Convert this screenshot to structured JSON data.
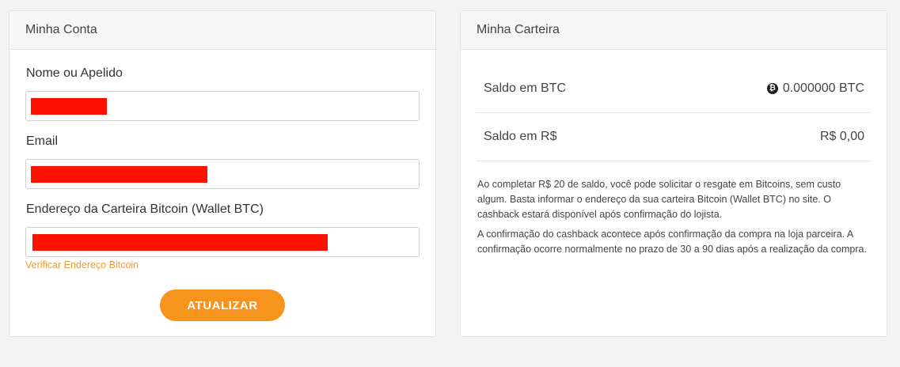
{
  "account": {
    "title": "Minha Conta",
    "fields": [
      {
        "label": "Nome ou Apelido",
        "value": ""
      },
      {
        "label": "Email",
        "value": ""
      },
      {
        "label": "Endereço da Carteira Bitcoin (Wallet BTC)",
        "value": ""
      }
    ],
    "verify_link": "Verificar Endereço Bitcoin",
    "submit_label": "ATUALIZAR"
  },
  "wallet": {
    "title": "Minha Carteira",
    "btc_label": "Saldo em BTC",
    "btc_value": "0.000000 BTC",
    "brl_label": "Saldo em R$",
    "brl_value": "R$ 0,00",
    "note1": "Ao completar R$ 20 de saldo, você pode solicitar o resgate em Bitcoins, sem custo algum. Basta informar o endereço da sua carteira Bitcoin (Wallet BTC) no site. O cashback estará disponível após confirmação do lojista.",
    "note2": "A confirmação do cashback acontece após confirmação da compra na loja parceira. A confirmação ocorre normalmente no prazo de 30 a 90 dias após a realização da compra."
  },
  "colors": {
    "accent": "#f7941d",
    "link": "#ef9a3a",
    "redaction": "#ff1100"
  },
  "icons": {
    "btc": "bitcoin-icon"
  }
}
